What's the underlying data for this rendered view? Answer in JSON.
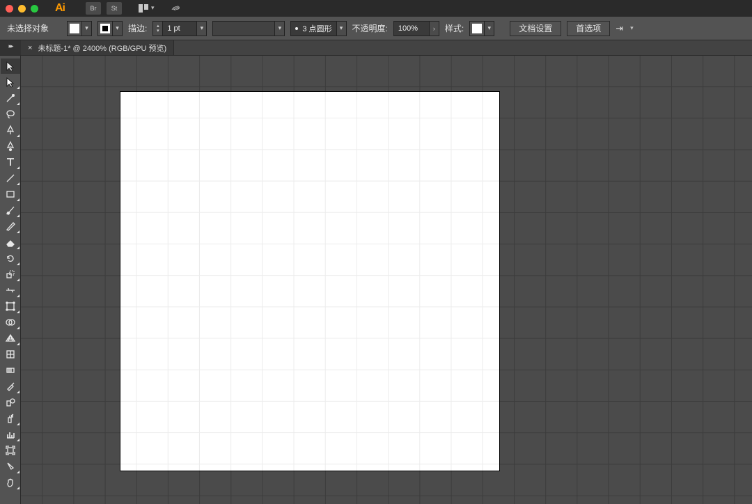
{
  "app": {
    "logo_text": "Ai",
    "bridge_chip": "Br",
    "stock_chip": "St"
  },
  "options": {
    "no_selection": "未选择对象",
    "stroke_label": "描边:",
    "stroke_value": "1 pt",
    "profile_value": "3 点圆形",
    "opacity_label": "不透明度:",
    "opacity_value": "100%",
    "style_label": "样式:",
    "doc_setup_btn": "文档设置",
    "prefs_btn": "首选项"
  },
  "tab": {
    "title": "未标题-1* @ 2400% (RGB/GPU 预览)",
    "close": "×"
  },
  "tools": [
    {
      "name": "selection-tool",
      "glyph": "arrow",
      "sel": true,
      "corner": false
    },
    {
      "name": "direct-select-tool",
      "glyph": "arrow-hollow",
      "sel": false,
      "corner": true
    },
    {
      "name": "magic-wand-tool",
      "glyph": "wand",
      "sel": false,
      "corner": true
    },
    {
      "name": "lasso-tool",
      "glyph": "lasso",
      "sel": false,
      "corner": false
    },
    {
      "name": "pen-tool",
      "glyph": "pen",
      "sel": false,
      "corner": true
    },
    {
      "name": "curvature-tool",
      "glyph": "curve-pen",
      "sel": false,
      "corner": false
    },
    {
      "name": "type-tool",
      "glyph": "type",
      "sel": false,
      "corner": true
    },
    {
      "name": "line-tool",
      "glyph": "line",
      "sel": false,
      "corner": true
    },
    {
      "name": "rectangle-tool",
      "glyph": "rect",
      "sel": false,
      "corner": true
    },
    {
      "name": "paintbrush-tool",
      "glyph": "brush",
      "sel": false,
      "corner": true
    },
    {
      "name": "pencil-tool",
      "glyph": "pencil",
      "sel": false,
      "corner": true
    },
    {
      "name": "eraser-tool",
      "glyph": "eraser",
      "sel": false,
      "corner": true
    },
    {
      "name": "rotate-tool",
      "glyph": "rotate",
      "sel": false,
      "corner": true
    },
    {
      "name": "scale-tool",
      "glyph": "scale",
      "sel": false,
      "corner": true
    },
    {
      "name": "width-tool",
      "glyph": "width",
      "sel": false,
      "corner": true
    },
    {
      "name": "free-transform-tool",
      "glyph": "freet",
      "sel": false,
      "corner": true
    },
    {
      "name": "shape-builder-tool",
      "glyph": "shapeb",
      "sel": false,
      "corner": true
    },
    {
      "name": "perspective-tool",
      "glyph": "persp",
      "sel": false,
      "corner": true
    },
    {
      "name": "mesh-tool",
      "glyph": "mesh",
      "sel": false,
      "corner": false
    },
    {
      "name": "gradient-tool",
      "glyph": "grad",
      "sel": false,
      "corner": false
    },
    {
      "name": "eyedropper-tool",
      "glyph": "eyedrop",
      "sel": false,
      "corner": true
    },
    {
      "name": "blend-tool",
      "glyph": "blend",
      "sel": false,
      "corner": false
    },
    {
      "name": "symbol-spray-tool",
      "glyph": "spray",
      "sel": false,
      "corner": true
    },
    {
      "name": "column-graph-tool",
      "glyph": "graph",
      "sel": false,
      "corner": true
    },
    {
      "name": "artboard-tool",
      "glyph": "artboard",
      "sel": false,
      "corner": false
    },
    {
      "name": "slice-tool",
      "glyph": "slice",
      "sel": false,
      "corner": true
    },
    {
      "name": "hand-tool",
      "glyph": "hand",
      "sel": false,
      "corner": true
    }
  ]
}
